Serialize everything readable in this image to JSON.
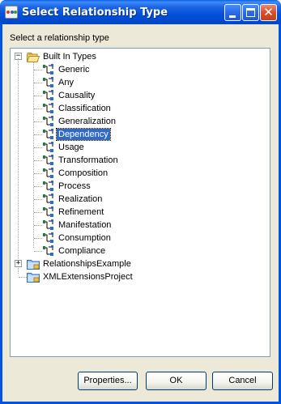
{
  "window": {
    "title": "Select Relationship Type"
  },
  "dialog": {
    "prompt": "Select a relationship type"
  },
  "tree": {
    "root": {
      "label": "Built In Types",
      "expanded": true,
      "children": [
        "Generic",
        "Any",
        "Causality",
        "Classification",
        "Generalization",
        "Dependency",
        "Usage",
        "Transformation",
        "Composition",
        "Process",
        "Realization",
        "Refinement",
        "Manifestation",
        "Consumption",
        "Compliance"
      ],
      "selected": "Dependency"
    },
    "projects": [
      {
        "label": "RelationshipsExample",
        "expander": "+"
      },
      {
        "label": "XMLExtensionsProject",
        "expander": ""
      }
    ],
    "root_expander": "−"
  },
  "buttons": {
    "properties": "Properties...",
    "ok": "OK",
    "cancel": "Cancel"
  },
  "colors": {
    "titlebar": "#0054e3",
    "selection": "#316ac5",
    "dialog_bg": "#ece9d8",
    "close_button": "#d6502e"
  }
}
